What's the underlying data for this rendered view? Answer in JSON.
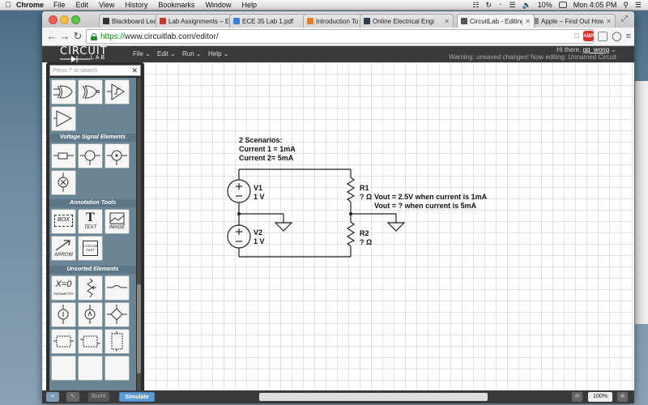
{
  "menubar": {
    "apple": "",
    "app": "Chrome",
    "items": [
      "File",
      "Edit",
      "View",
      "History",
      "Bookmarks",
      "Window",
      "Help"
    ],
    "battery": "10%",
    "clock": "Mon 4:05 PM"
  },
  "tabs": [
    {
      "label": "Blackboard Learn",
      "color": "#333333"
    },
    {
      "label": "Lab Assignments – E",
      "color": "#c0392b"
    },
    {
      "label": "ECE 35 Lab 1.pdf",
      "color": "#3b7dd8"
    },
    {
      "label": "Introduction To Electr",
      "color": "#e67e22"
    },
    {
      "label": "Online Electrical Engi",
      "color": "#2c3e50"
    },
    {
      "label": "CircuitLab - Editing \"",
      "color": "#555555",
      "active": true
    },
    {
      "label": "Apple – Find Out How",
      "color": "#888888"
    }
  ],
  "address": {
    "https": "https://",
    "rest": "www.circuitlab.com/editor/"
  },
  "header": {
    "logo_top": "CIRCUIT",
    "logo_bottom": "LAB",
    "menus": [
      "File",
      "Edit",
      "Run",
      "Help"
    ],
    "greeting": "Hi there,",
    "user": "gg_wong",
    "warning": "Warning: unsaved changes! Now editing: Unnamed Circuit"
  },
  "panel": {
    "search_placeholder": "Press '/' to search",
    "sections": [
      "Voltage Signal Elements",
      "Annotation Tools",
      "Unsorted Elements"
    ],
    "annotation_tiles": [
      "BOX",
      "TEXT",
      "IMAGE",
      "ARROW",
      "CUSTOM PART"
    ],
    "param_tile": "X=0",
    "param_sub": "PARAMETER"
  },
  "circuit": {
    "notes": [
      "2 Scenarios:",
      "Current 1 = 1mA",
      "Current 2= 5mA"
    ],
    "v1_name": "V1",
    "v1_value": "1 V",
    "v2_name": "V2",
    "v2_value": "1 V",
    "r1_name": "R1",
    "r1_value": "? Ω",
    "r1_note1": "Vout = 2.5V when current is 1mA",
    "r1_note2": "Vout = ? when current is 5mA",
    "r2_name": "R2",
    "r2_value": "? Ω"
  },
  "bottom": {
    "build": "Build",
    "simulate": "Simulate",
    "zoom": "100%"
  }
}
